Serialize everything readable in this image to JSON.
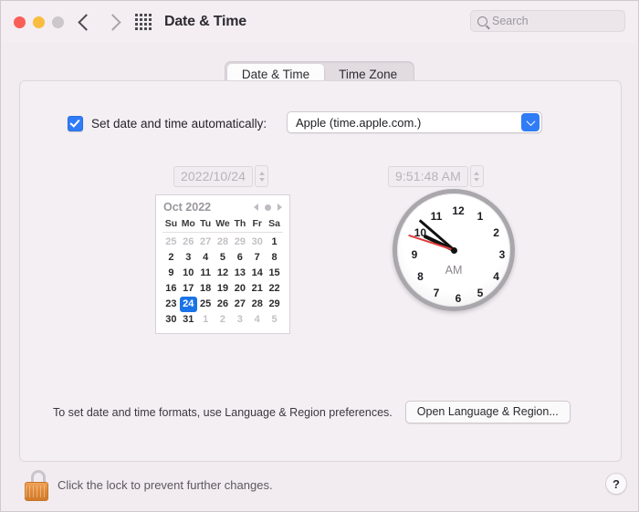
{
  "window": {
    "title": "Date & Time",
    "traffic_lights": [
      "close",
      "minimize",
      "maximize"
    ],
    "back_label": "Back",
    "forward_label": "Forward",
    "grid_label": "Show All"
  },
  "search": {
    "placeholder": "Search",
    "value": ""
  },
  "tabs": [
    {
      "label": "Date & Time",
      "active": true
    },
    {
      "label": "Time Zone",
      "active": false
    }
  ],
  "auto": {
    "checked": true,
    "label": "Set date and time automatically:",
    "server_value": "Apple (time.apple.com.)",
    "server_options": [
      "Apple (time.apple.com.)"
    ]
  },
  "date_field": {
    "value": "2022/10/24",
    "enabled": false
  },
  "time_field": {
    "value": "9:51:48 AM",
    "enabled": false
  },
  "calendar": {
    "month_label": "Oct 2022",
    "weekdays": [
      "Su",
      "Mo",
      "Tu",
      "We",
      "Th",
      "Fr",
      "Sa"
    ],
    "selected_day": 24,
    "weeks": [
      [
        {
          "d": "25",
          "muted": true
        },
        {
          "d": "26",
          "muted": true
        },
        {
          "d": "27",
          "muted": true
        },
        {
          "d": "28",
          "muted": true
        },
        {
          "d": "29",
          "muted": true
        },
        {
          "d": "30",
          "muted": true
        },
        {
          "d": "1",
          "muted": false
        }
      ],
      [
        {
          "d": "2",
          "muted": false
        },
        {
          "d": "3",
          "muted": false
        },
        {
          "d": "4",
          "muted": false
        },
        {
          "d": "5",
          "muted": false
        },
        {
          "d": "6",
          "muted": false
        },
        {
          "d": "7",
          "muted": false
        },
        {
          "d": "8",
          "muted": false
        }
      ],
      [
        {
          "d": "9",
          "muted": false
        },
        {
          "d": "10",
          "muted": false
        },
        {
          "d": "11",
          "muted": false
        },
        {
          "d": "12",
          "muted": false
        },
        {
          "d": "13",
          "muted": false
        },
        {
          "d": "14",
          "muted": false
        },
        {
          "d": "15",
          "muted": false
        }
      ],
      [
        {
          "d": "16",
          "muted": false
        },
        {
          "d": "17",
          "muted": false
        },
        {
          "d": "18",
          "muted": false
        },
        {
          "d": "19",
          "muted": false
        },
        {
          "d": "20",
          "muted": false
        },
        {
          "d": "21",
          "muted": false
        },
        {
          "d": "22",
          "muted": false
        }
      ],
      [
        {
          "d": "23",
          "muted": false
        },
        {
          "d": "24",
          "muted": false,
          "selected": true
        },
        {
          "d": "25",
          "muted": false
        },
        {
          "d": "26",
          "muted": false
        },
        {
          "d": "27",
          "muted": false
        },
        {
          "d": "28",
          "muted": false
        },
        {
          "d": "29",
          "muted": false
        }
      ],
      [
        {
          "d": "30",
          "muted": false
        },
        {
          "d": "31",
          "muted": false
        },
        {
          "d": "1",
          "muted": true
        },
        {
          "d": "2",
          "muted": true
        },
        {
          "d": "3",
          "muted": true
        },
        {
          "d": "4",
          "muted": true
        },
        {
          "d": "5",
          "muted": true
        }
      ]
    ]
  },
  "clock": {
    "meridiem": "AM",
    "hour": 9,
    "minute": 51,
    "second": 48,
    "numerals": [
      "12",
      "1",
      "2",
      "3",
      "4",
      "5",
      "6",
      "7",
      "8",
      "9",
      "10",
      "11"
    ],
    "hand_colors": {
      "hour": "#111111",
      "minute": "#111111",
      "second": "#e23b3b"
    }
  },
  "formats": {
    "note": "To set date and time formats, use Language & Region preferences.",
    "button_label": "Open Language & Region..."
  },
  "bottom": {
    "lock_state": "unlocked",
    "lock_text": "Click the lock to prevent further changes.",
    "help_label": "?"
  },
  "colors": {
    "accent_blue": "#2f7cf6",
    "selection_blue": "#1a73e8",
    "window_bg": "#f2ecf0",
    "card_bg": "#f4eff3",
    "lock_orange": "#e08a38"
  }
}
